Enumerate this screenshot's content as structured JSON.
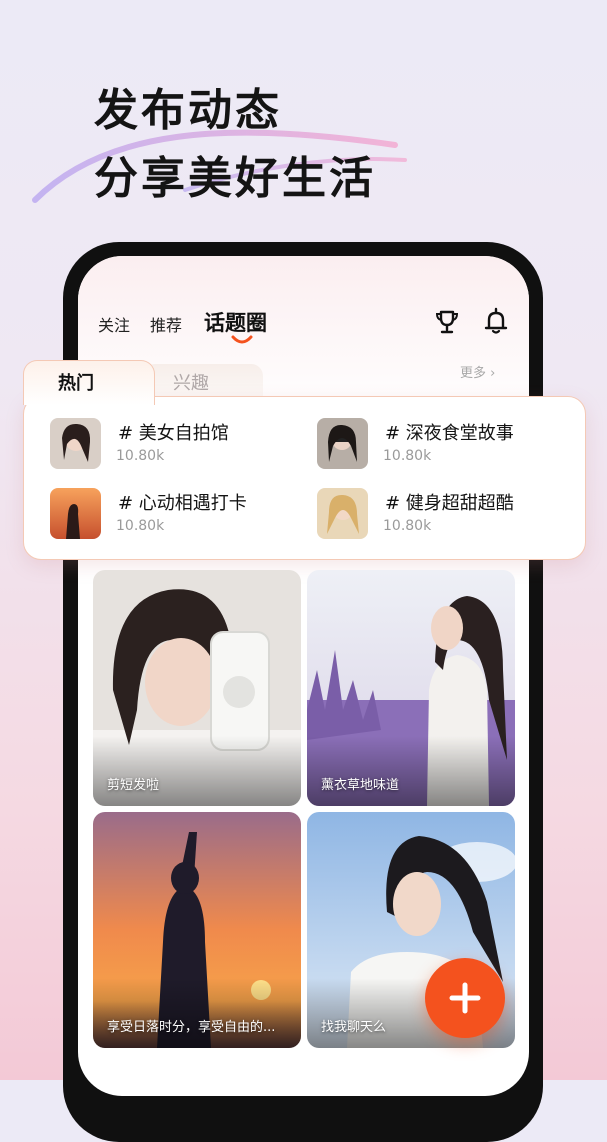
{
  "headline": {
    "line1": "发布动态",
    "line2": "分享美好生活"
  },
  "top_tabs": {
    "follow": "关注",
    "recommend": "推荐",
    "topics": "话题圈"
  },
  "icons": {
    "trophy": "trophy-icon",
    "bell": "bell-icon",
    "more": "chevron-right-icon",
    "add": "plus-icon"
  },
  "topic_card": {
    "tab_hot": "热门",
    "tab_interest": "兴趣",
    "more": "更多 ›",
    "topics": [
      {
        "title": "# 美女自拍馆",
        "count": "10.80k"
      },
      {
        "title": "# 深夜食堂故事",
        "count": "10.80k"
      },
      {
        "title": "# 心动相遇打卡",
        "count": "10.80k"
      },
      {
        "title": "# 健身超甜超酷",
        "count": "10.80k"
      }
    ]
  },
  "feed": [
    {
      "caption": "剪短发啦"
    },
    {
      "caption": "薰衣草地味道"
    },
    {
      "caption": "享受日落时分，享受自由的..."
    },
    {
      "caption": "找我聊天么"
    }
  ],
  "colors": {
    "accent": "#f4521e",
    "card_border": "#f4c9b5"
  }
}
